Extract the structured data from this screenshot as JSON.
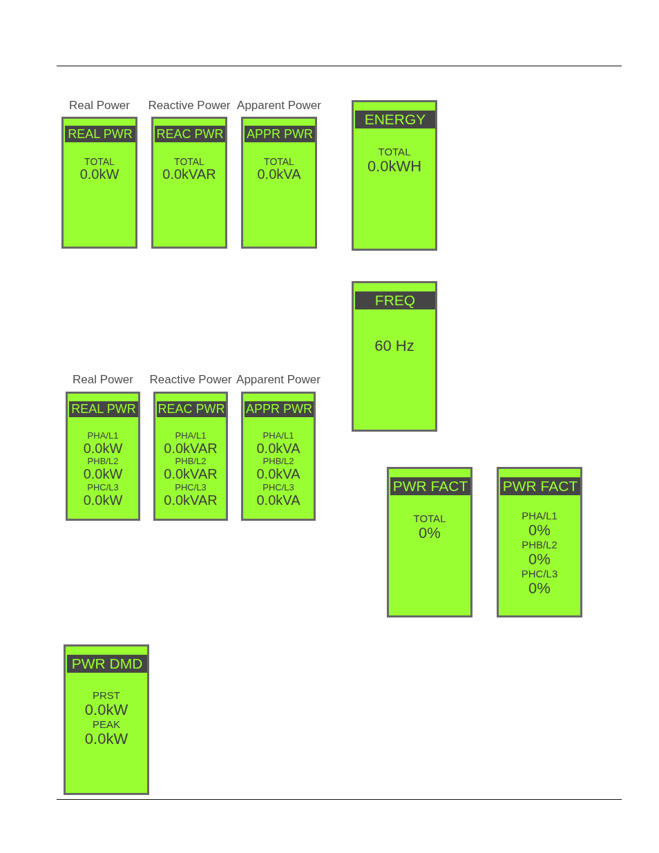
{
  "totals_group": {
    "panels": [
      {
        "caption": "Real Power",
        "title": "REAL PWR",
        "readings": [
          {
            "label": "TOTAL",
            "value": "0.0kW"
          }
        ]
      },
      {
        "caption": "Reactive Power",
        "title": "REAC PWR",
        "readings": [
          {
            "label": "TOTAL",
            "value": "0.0kVAR"
          }
        ]
      },
      {
        "caption": "Apparent Power",
        "title": "APPR PWR",
        "readings": [
          {
            "label": "TOTAL",
            "value": "0.0kVA"
          }
        ]
      }
    ]
  },
  "energy_display": {
    "title": "ENERGY",
    "readings": [
      {
        "label": "TOTAL",
        "value": "0.0kWH"
      }
    ]
  },
  "frequency_display": {
    "title": "FREQ",
    "readings": [
      {
        "value": "60 Hz"
      }
    ]
  },
  "per_phase_group": {
    "panels": [
      {
        "caption": "Real Power",
        "title": "REAL PWR",
        "readings": [
          {
            "label": "PHA/L1",
            "value": "0.0kW"
          },
          {
            "label": "PHB/L2",
            "value": "0.0kW"
          },
          {
            "label": "PHC/L3",
            "value": "0.0kW"
          }
        ]
      },
      {
        "caption": "Reactive Power",
        "title": "REAC PWR",
        "readings": [
          {
            "label": "PHA/L1",
            "value": "0.0kVAR"
          },
          {
            "label": "PHB/L2",
            "value": "0.0kVAR"
          },
          {
            "label": "PHC/L3",
            "value": "0.0kVAR"
          }
        ]
      },
      {
        "caption": "Apparent Power",
        "title": "APPR PWR",
        "readings": [
          {
            "label": "PHA/L1",
            "value": "0.0kVA"
          },
          {
            "label": "PHB/L2",
            "value": "0.0kVA"
          },
          {
            "label": "PHC/L3",
            "value": "0.0kVA"
          }
        ]
      }
    ]
  },
  "power_factor_displays": [
    {
      "title": "PWR FACT",
      "readings": [
        {
          "label": "TOTAL",
          "value": "0%"
        }
      ]
    },
    {
      "title": "PWR FACT",
      "readings": [
        {
          "label": "PHA/L1",
          "value": "0%"
        },
        {
          "label": "PHB/L2",
          "value": "0%"
        },
        {
          "label": "PHC/L3",
          "value": "0%"
        }
      ]
    }
  ],
  "demand_display": {
    "title": "PWR DMD",
    "readings": [
      {
        "label": "PRST",
        "value": "0.0kW"
      },
      {
        "label": "PEAK",
        "value": "0.0kW"
      }
    ]
  }
}
